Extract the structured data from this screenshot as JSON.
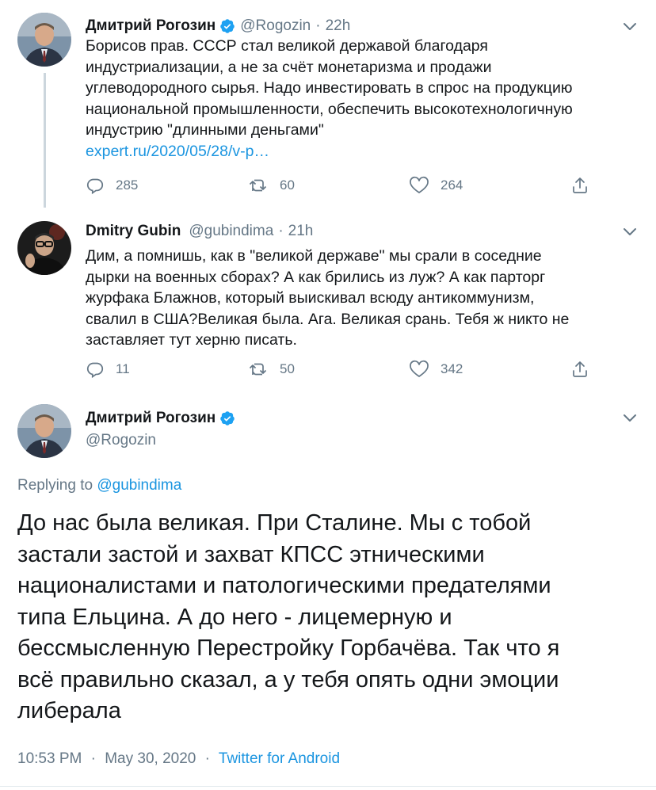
{
  "tweets": [
    {
      "name": "Дмитрий Рогозин",
      "verified": true,
      "handle": "@Rogozin",
      "separator": "·",
      "time": "22h",
      "lines": [
        "Борисов прав. СССР стал великой державой благодаря",
        "индустриализации, а не за счёт монетаризма и продажи",
        "углеводородного сырья. Надо инвестировать в спрос на продукцию",
        "национальной промышленности, обеспечить высокотехнологичную",
        "индустрию \"длинными деньгами\""
      ],
      "link": "expert.ru/2020/05/28/v-p…",
      "replies": "285",
      "retweets": "60",
      "likes": "264"
    },
    {
      "name": "Dmitry Gubin",
      "verified": false,
      "handle": "@gubindima",
      "separator": "·",
      "time": "21h",
      "lines": [
        "Дим, а помнишь, как в \"великой державе\" мы срали в соседние",
        "дырки на военных сборах? А как брились из луж? А как парторг",
        "журфака Блажнов, который выискивал всюду антикоммунизм,",
        "свалил в США?Великая была. Ага. Великая срань. Тебя ж никто не",
        "заставляет тут херню писать."
      ],
      "replies": "11",
      "retweets": "50",
      "likes": "342"
    }
  ],
  "main": {
    "name": "Дмитрий Рогозин",
    "verified": true,
    "handle": "@Rogozin",
    "replying_prefix": "Replying to",
    "replying_handle": "@gubindima",
    "lines": [
      "До нас была великая. При Сталине. Мы с тобой",
      "застали застой и захват КПСС этническими",
      "националистами и патологическими предателями",
      "типа Ельцина. А до него - лицемерную и",
      "бессмысленную Перестройку Горбачёва. Так что я",
      "всё правильно сказал, а у тебя опять одни эмоции",
      "либерала"
    ],
    "time": "10:53 PM",
    "separator": "·",
    "date": "May 30, 2020",
    "app": "Twitter for Android"
  },
  "icons": {
    "reply": "reply-icon",
    "retweet": "retweet-icon",
    "like": "heart-icon",
    "share": "share-icon",
    "caret": "chevron-down-icon",
    "verified": "verified-badge-icon"
  },
  "colors": {
    "text": "#14171a",
    "secondary": "#657786",
    "link": "#1b95e0",
    "verified": "#1da1f2",
    "thread_line": "#ccd6dd"
  }
}
